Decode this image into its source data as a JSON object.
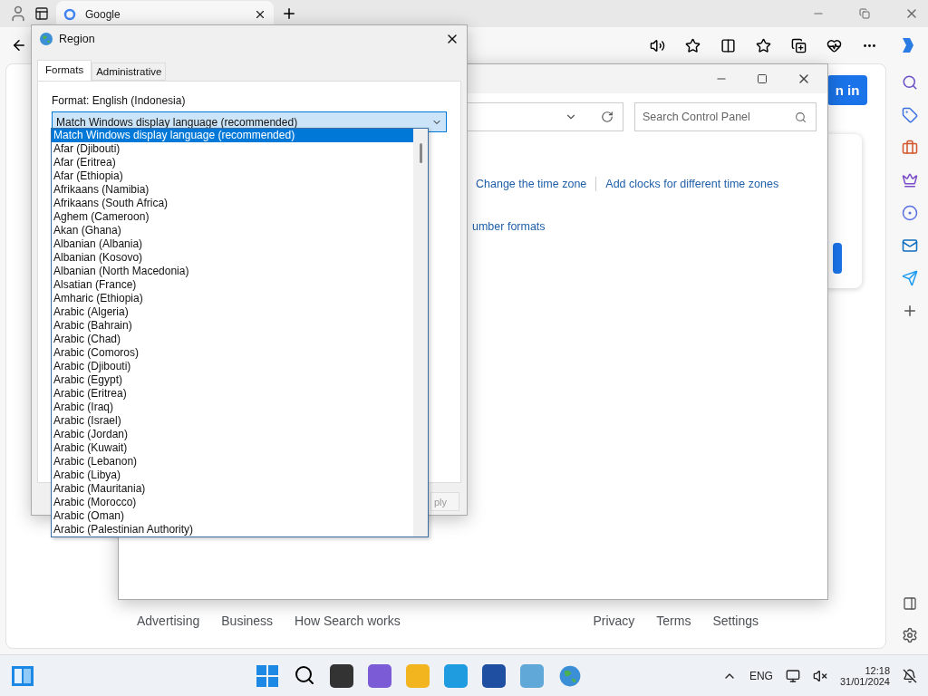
{
  "browser": {
    "tab_title": "Google",
    "page": {
      "sign_in_button": "n in",
      "footer_links_left": [
        "Advertising",
        "Business",
        "How Search works"
      ],
      "footer_links_right": [
        "Privacy",
        "Terms",
        "Settings"
      ]
    }
  },
  "control_panel": {
    "search": {
      "placeholder": "Search Control Panel"
    },
    "links": [
      "Change the time zone",
      "Add clocks for different time zones"
    ],
    "partial_link": "umber formats"
  },
  "region_dialog": {
    "title": "Region",
    "tabs": [
      {
        "label": "Formats",
        "selected": true
      },
      {
        "label": "Administrative",
        "selected": false
      }
    ],
    "format_label": "Format: English (Indonesia)",
    "combo_value": "Match Windows display language (recommended)",
    "options": [
      {
        "label": "Match Windows display language (recommended)",
        "selected": true
      },
      {
        "label": "Afar (Djibouti)",
        "selected": false
      },
      {
        "label": "Afar (Eritrea)",
        "selected": false
      },
      {
        "label": "Afar (Ethiopia)",
        "selected": false
      },
      {
        "label": "Afrikaans (Namibia)",
        "selected": false
      },
      {
        "label": "Afrikaans (South Africa)",
        "selected": false
      },
      {
        "label": "Aghem (Cameroon)",
        "selected": false
      },
      {
        "label": "Akan (Ghana)",
        "selected": false
      },
      {
        "label": "Albanian (Albania)",
        "selected": false
      },
      {
        "label": "Albanian (Kosovo)",
        "selected": false
      },
      {
        "label": "Albanian (North Macedonia)",
        "selected": false
      },
      {
        "label": "Alsatian (France)",
        "selected": false
      },
      {
        "label": "Amharic (Ethiopia)",
        "selected": false
      },
      {
        "label": "Arabic (Algeria)",
        "selected": false
      },
      {
        "label": "Arabic (Bahrain)",
        "selected": false
      },
      {
        "label": "Arabic (Chad)",
        "selected": false
      },
      {
        "label": "Arabic (Comoros)",
        "selected": false
      },
      {
        "label": "Arabic (Djibouti)",
        "selected": false
      },
      {
        "label": "Arabic (Egypt)",
        "selected": false
      },
      {
        "label": "Arabic (Eritrea)",
        "selected": false
      },
      {
        "label": "Arabic (Iraq)",
        "selected": false
      },
      {
        "label": "Arabic (Israel)",
        "selected": false
      },
      {
        "label": "Arabic (Jordan)",
        "selected": false
      },
      {
        "label": "Arabic (Kuwait)",
        "selected": false
      },
      {
        "label": "Arabic (Lebanon)",
        "selected": false
      },
      {
        "label": "Arabic (Libya)",
        "selected": false
      },
      {
        "label": "Arabic (Mauritania)",
        "selected": false
      },
      {
        "label": "Arabic (Morocco)",
        "selected": false
      },
      {
        "label": "Arabic (Oman)",
        "selected": false
      },
      {
        "label": "Arabic (Palestinian Authority)",
        "selected": false
      }
    ],
    "partial_button": "ply"
  },
  "taskbar": {
    "language": "ENG",
    "time": "12:18",
    "date": "31/01/2024"
  }
}
